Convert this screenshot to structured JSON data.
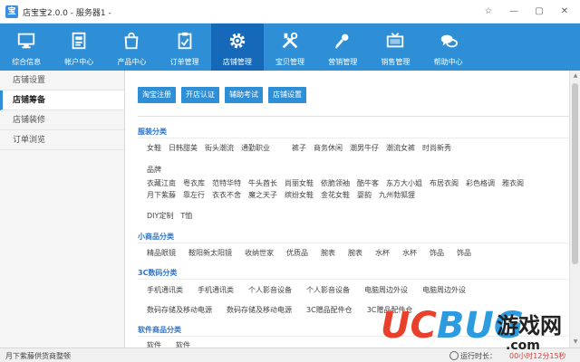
{
  "window": {
    "title": "店宝宝2.0.0 - 服务器1 -",
    "app_icon_glyph": "宝",
    "controls": [
      "☆",
      "—",
      "▢",
      "✕"
    ]
  },
  "nav": [
    {
      "label": "综合信息",
      "icon": "monitor-icon"
    },
    {
      "label": "帐户中心",
      "icon": "account-card-icon"
    },
    {
      "label": "产品中心",
      "icon": "shopping-bag-icon"
    },
    {
      "label": "订单管理",
      "icon": "order-clipboard-icon"
    },
    {
      "label": "店铺管理",
      "icon": "gear-icon",
      "active": true
    },
    {
      "label": "宝贝管理",
      "icon": "tools-icon"
    },
    {
      "label": "营销管理",
      "icon": "microphone-icon"
    },
    {
      "label": "销售管理",
      "icon": "tv-icon"
    },
    {
      "label": "帮助中心",
      "icon": "chat-bubbles-icon"
    }
  ],
  "sidebar": [
    {
      "label": "店铺设置"
    },
    {
      "label": "店铺筹备",
      "active": true
    },
    {
      "label": "店铺装修"
    },
    {
      "label": "订单浏览"
    }
  ],
  "toolbar": [
    "淘宝注册",
    "开店认证",
    "辅助考试",
    "店铺设置"
  ],
  "categories": [
    {
      "title": "服装分类",
      "rows": [
        [
          "女鞋",
          "日韩甜美",
          "街头潮流",
          "通勤职业",
          "裤子",
          "商务休闲",
          "潮男牛仔",
          "潮流女裤",
          "时尚新秀"
        ],
        [
          "品牌"
        ],
        [
          "衣藏江南",
          "粤衣库",
          "范特华特",
          "牛头酋长",
          "尚丽女鞋",
          "依脆领袖",
          "酷牛客",
          "东方大小姐",
          "布居衣阁",
          "彩色格调",
          "雅衣阁"
        ],
        [
          "月下紫藤",
          "靠左行",
          "衣衣不舍",
          "魔之天子",
          "缤纷女鞋",
          "金花女鞋",
          "婴韵",
          "九州勃狐狸"
        ],
        [
          "DIY定制",
          "T恤"
        ]
      ]
    },
    {
      "title": "小商品分类",
      "rows": [
        [
          "精品眼镜",
          "鞍阳新太阳镜",
          "收纳世家",
          "优质品",
          "腕表",
          "腕表",
          "水杯",
          "水杯",
          "饰品",
          "饰品"
        ]
      ]
    },
    {
      "title": "3C数码分类",
      "rows": [
        [
          "手机通讯类",
          "手机通讯类",
          "个人影音设备",
          "个人影音设备",
          "电脑周边外设",
          "电脑周边外设"
        ],
        [
          "数码存储及移动电源",
          "数码存储及移动电源",
          "3C赠品配件仓",
          "3C赠品配件仓"
        ]
      ]
    },
    {
      "title": "软件商品分类",
      "rows": [
        [
          "软件",
          "软件"
        ]
      ]
    }
  ],
  "status": {
    "text": "月下紫藤供货商整顿",
    "runtime_label": "运行时长：",
    "runtime_value": "00小时12分15秒"
  },
  "watermark": {
    "uc": "UC",
    "bug": "BUG",
    "cn": "游戏网",
    "com": ".com"
  }
}
